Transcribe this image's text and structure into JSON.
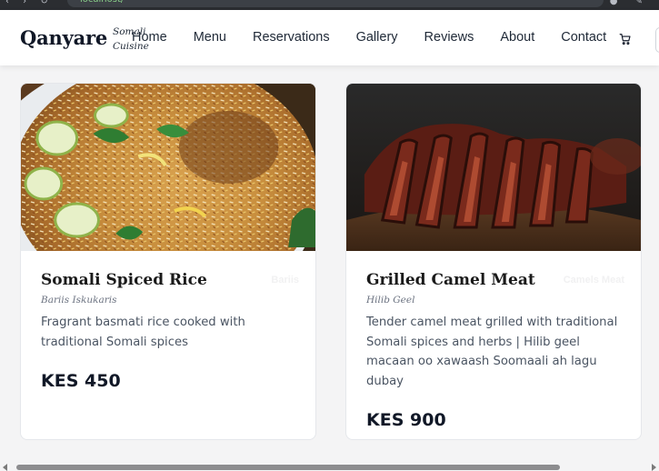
{
  "browser": {
    "url": "localhost/"
  },
  "header": {
    "brand_name": "Qanyare",
    "brand_sub_line1": "Somali",
    "brand_sub_line2": "Cuisine",
    "nav": [
      "Home",
      "Menu",
      "Reservations",
      "Gallery",
      "Reviews",
      "About",
      "Contact"
    ],
    "cart_icon": "cart-icon"
  },
  "cards": [
    {
      "title": "Somali Spiced Rice",
      "ghost_tag": "Bariis",
      "local_name": "Bariis Iskukaris",
      "description": "Fragrant basmati rice cooked with traditional Somali spices",
      "price": "KES 450",
      "image": "spiced-rice-photo"
    },
    {
      "title": "Grilled Camel Meat",
      "ghost_tag": "Camels Meat",
      "local_name": "Hilib Geel",
      "description": "Tender camel meat grilled with traditional Somali spices and herbs | Hilib geel macaan oo xawaash Soomaali ah lagu dubay",
      "price": "KES 900",
      "image": "grilled-camel-meat-photo"
    }
  ],
  "colors": {
    "page_bg": "#f4f4f5",
    "header_bg": "#ffffff",
    "text_dark": "#111827",
    "text_muted": "#4b5563"
  }
}
